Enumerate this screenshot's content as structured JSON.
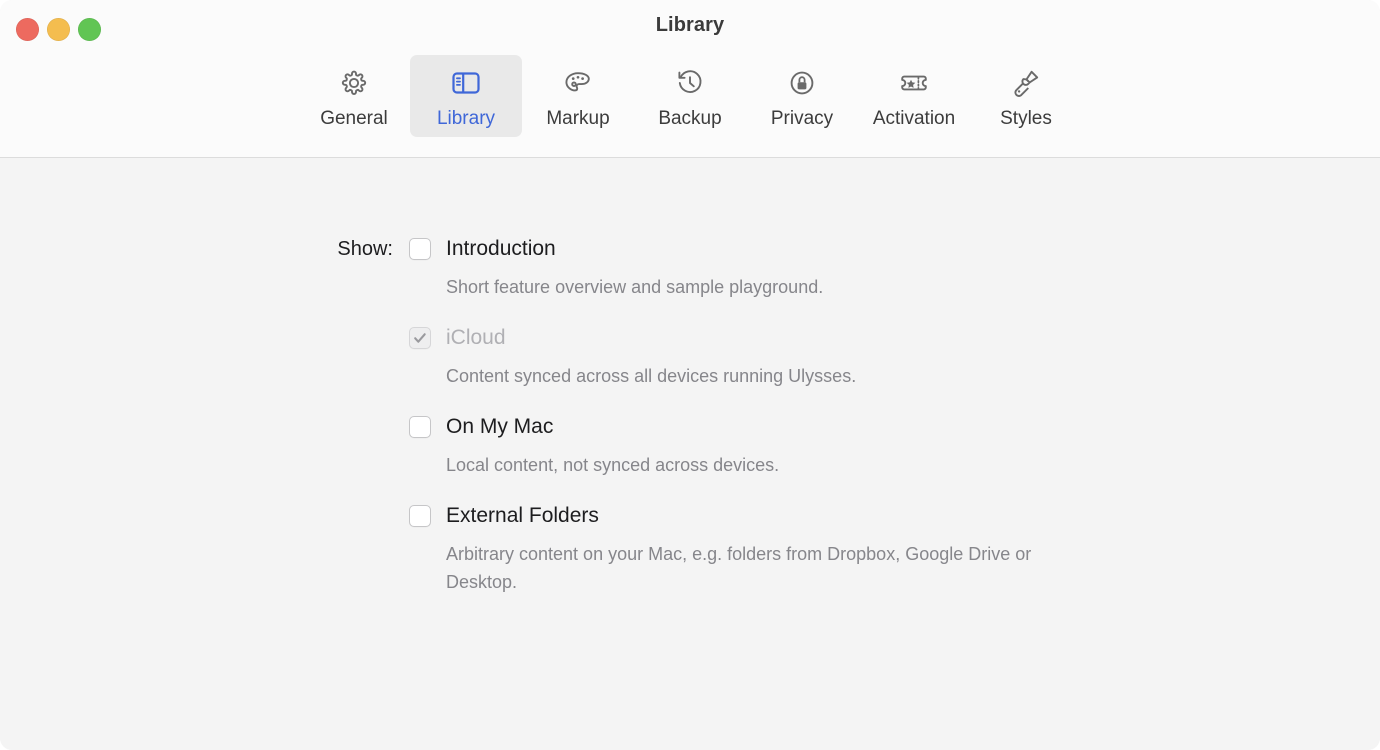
{
  "window": {
    "title": "Library",
    "traffic_lights": [
      {
        "name": "close",
        "color": "#ed6a5f"
      },
      {
        "name": "minimize",
        "color": "#f4bd4f"
      },
      {
        "name": "maximize",
        "color": "#61c554"
      }
    ]
  },
  "accent_color": "#3f67d8",
  "toolbar": {
    "tabs": [
      {
        "label": "General",
        "icon": "gear-icon",
        "selected": false
      },
      {
        "label": "Library",
        "icon": "library-icon",
        "selected": true
      },
      {
        "label": "Markup",
        "icon": "palette-icon",
        "selected": false
      },
      {
        "label": "Backup",
        "icon": "clock-back-icon",
        "selected": false
      },
      {
        "label": "Privacy",
        "icon": "lock-icon",
        "selected": false
      },
      {
        "label": "Activation",
        "icon": "ticket-icon",
        "selected": false
      },
      {
        "label": "Styles",
        "icon": "paintbrush-icon",
        "selected": false
      }
    ]
  },
  "main": {
    "show_label": "Show:",
    "options": [
      {
        "label": "Introduction",
        "description": "Short feature overview and sample playground.",
        "checked": false,
        "disabled": false
      },
      {
        "label": "iCloud",
        "description": "Content synced across all devices running Ulysses.",
        "checked": true,
        "disabled": true
      },
      {
        "label": "On My Mac",
        "description": "Local content, not synced across devices.",
        "checked": false,
        "disabled": false
      },
      {
        "label": "External Folders",
        "description": "Arbitrary content on your Mac, e.g. folders from Dropbox, Google Drive or Desktop.",
        "checked": false,
        "disabled": false
      }
    ]
  }
}
